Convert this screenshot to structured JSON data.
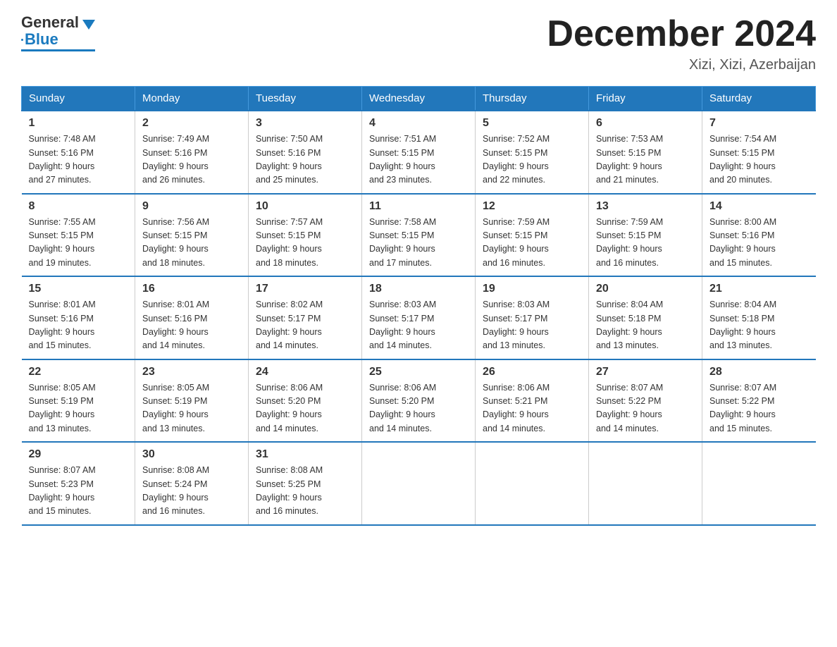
{
  "header": {
    "logo_general": "General",
    "logo_blue": "Blue",
    "month_title": "December 2024",
    "location": "Xizi, Xizi, Azerbaijan"
  },
  "days_of_week": [
    "Sunday",
    "Monday",
    "Tuesday",
    "Wednesday",
    "Thursday",
    "Friday",
    "Saturday"
  ],
  "weeks": [
    [
      {
        "num": "1",
        "sunrise": "7:48 AM",
        "sunset": "5:16 PM",
        "daylight": "9 hours and 27 minutes."
      },
      {
        "num": "2",
        "sunrise": "7:49 AM",
        "sunset": "5:16 PM",
        "daylight": "9 hours and 26 minutes."
      },
      {
        "num": "3",
        "sunrise": "7:50 AM",
        "sunset": "5:16 PM",
        "daylight": "9 hours and 25 minutes."
      },
      {
        "num": "4",
        "sunrise": "7:51 AM",
        "sunset": "5:15 PM",
        "daylight": "9 hours and 23 minutes."
      },
      {
        "num": "5",
        "sunrise": "7:52 AM",
        "sunset": "5:15 PM",
        "daylight": "9 hours and 22 minutes."
      },
      {
        "num": "6",
        "sunrise": "7:53 AM",
        "sunset": "5:15 PM",
        "daylight": "9 hours and 21 minutes."
      },
      {
        "num": "7",
        "sunrise": "7:54 AM",
        "sunset": "5:15 PM",
        "daylight": "9 hours and 20 minutes."
      }
    ],
    [
      {
        "num": "8",
        "sunrise": "7:55 AM",
        "sunset": "5:15 PM",
        "daylight": "9 hours and 19 minutes."
      },
      {
        "num": "9",
        "sunrise": "7:56 AM",
        "sunset": "5:15 PM",
        "daylight": "9 hours and 18 minutes."
      },
      {
        "num": "10",
        "sunrise": "7:57 AM",
        "sunset": "5:15 PM",
        "daylight": "9 hours and 18 minutes."
      },
      {
        "num": "11",
        "sunrise": "7:58 AM",
        "sunset": "5:15 PM",
        "daylight": "9 hours and 17 minutes."
      },
      {
        "num": "12",
        "sunrise": "7:59 AM",
        "sunset": "5:15 PM",
        "daylight": "9 hours and 16 minutes."
      },
      {
        "num": "13",
        "sunrise": "7:59 AM",
        "sunset": "5:15 PM",
        "daylight": "9 hours and 16 minutes."
      },
      {
        "num": "14",
        "sunrise": "8:00 AM",
        "sunset": "5:16 PM",
        "daylight": "9 hours and 15 minutes."
      }
    ],
    [
      {
        "num": "15",
        "sunrise": "8:01 AM",
        "sunset": "5:16 PM",
        "daylight": "9 hours and 15 minutes."
      },
      {
        "num": "16",
        "sunrise": "8:01 AM",
        "sunset": "5:16 PM",
        "daylight": "9 hours and 14 minutes."
      },
      {
        "num": "17",
        "sunrise": "8:02 AM",
        "sunset": "5:17 PM",
        "daylight": "9 hours and 14 minutes."
      },
      {
        "num": "18",
        "sunrise": "8:03 AM",
        "sunset": "5:17 PM",
        "daylight": "9 hours and 14 minutes."
      },
      {
        "num": "19",
        "sunrise": "8:03 AM",
        "sunset": "5:17 PM",
        "daylight": "9 hours and 13 minutes."
      },
      {
        "num": "20",
        "sunrise": "8:04 AM",
        "sunset": "5:18 PM",
        "daylight": "9 hours and 13 minutes."
      },
      {
        "num": "21",
        "sunrise": "8:04 AM",
        "sunset": "5:18 PM",
        "daylight": "9 hours and 13 minutes."
      }
    ],
    [
      {
        "num": "22",
        "sunrise": "8:05 AM",
        "sunset": "5:19 PM",
        "daylight": "9 hours and 13 minutes."
      },
      {
        "num": "23",
        "sunrise": "8:05 AM",
        "sunset": "5:19 PM",
        "daylight": "9 hours and 13 minutes."
      },
      {
        "num": "24",
        "sunrise": "8:06 AM",
        "sunset": "5:20 PM",
        "daylight": "9 hours and 14 minutes."
      },
      {
        "num": "25",
        "sunrise": "8:06 AM",
        "sunset": "5:20 PM",
        "daylight": "9 hours and 14 minutes."
      },
      {
        "num": "26",
        "sunrise": "8:06 AM",
        "sunset": "5:21 PM",
        "daylight": "9 hours and 14 minutes."
      },
      {
        "num": "27",
        "sunrise": "8:07 AM",
        "sunset": "5:22 PM",
        "daylight": "9 hours and 14 minutes."
      },
      {
        "num": "28",
        "sunrise": "8:07 AM",
        "sunset": "5:22 PM",
        "daylight": "9 hours and 15 minutes."
      }
    ],
    [
      {
        "num": "29",
        "sunrise": "8:07 AM",
        "sunset": "5:23 PM",
        "daylight": "9 hours and 15 minutes."
      },
      {
        "num": "30",
        "sunrise": "8:08 AM",
        "sunset": "5:24 PM",
        "daylight": "9 hours and 16 minutes."
      },
      {
        "num": "31",
        "sunrise": "8:08 AM",
        "sunset": "5:25 PM",
        "daylight": "9 hours and 16 minutes."
      },
      null,
      null,
      null,
      null
    ]
  ]
}
